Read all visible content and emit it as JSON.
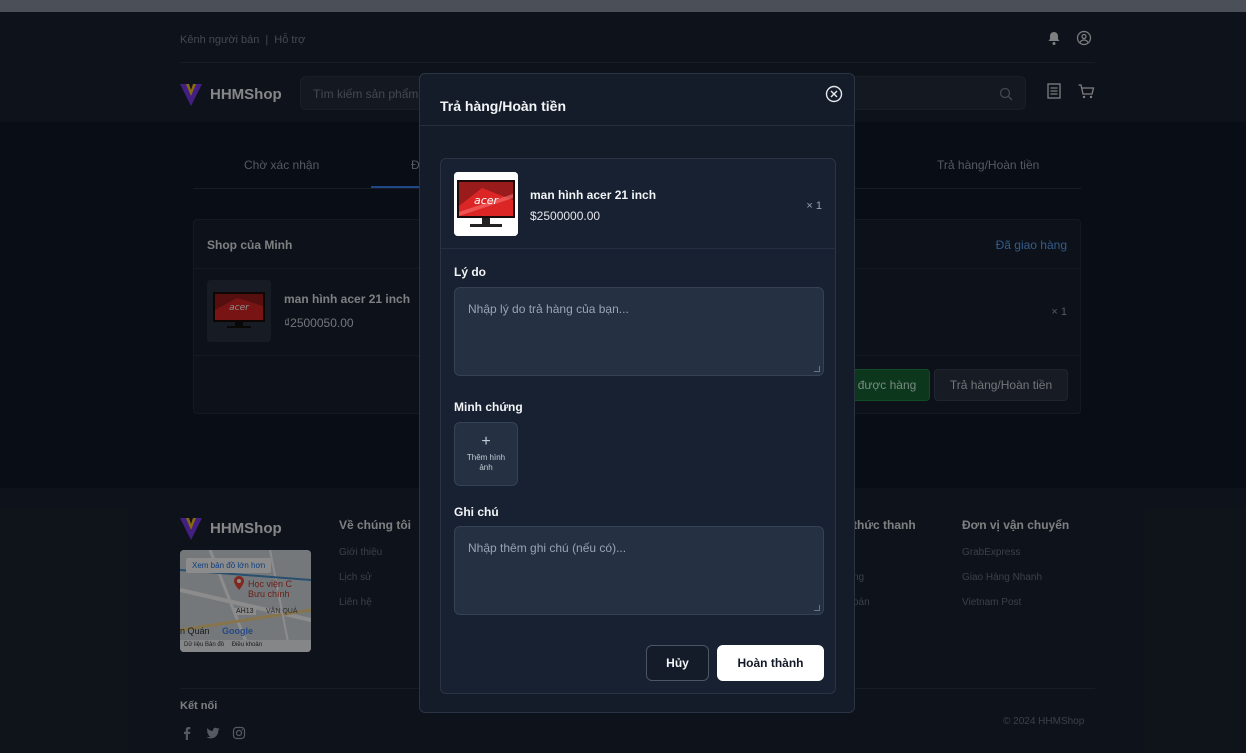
{
  "topbar": {
    "seller_channel": "Kênh người bán",
    "separator": "|",
    "support": "Hỗ trợ"
  },
  "header": {
    "brand": "HHMShop",
    "search_placeholder": "Tìm kiếm sản phẩm"
  },
  "tabs": [
    {
      "label": "Chờ xác nhận"
    },
    {
      "label": "Đ"
    },
    {
      "label": "Trả hàng/Hoàn tiền"
    }
  ],
  "order": {
    "shop_name": "Shop của Minh",
    "status": "Đã giao hàng",
    "product_name": "man hình acer 21 inch",
    "product_price": "₫2500050.00",
    "quantity": "× 1",
    "received_button": "được hàng",
    "return_button": "Trả hàng/Hoàn tiền"
  },
  "footer": {
    "brand": "HHMShop",
    "map": {
      "view_larger": "Xem bản đồ lớn hơn",
      "place_name": "Học viện C",
      "place_name2": "Bưu chính",
      "road": "AH13",
      "area": "VĂN QUÁ",
      "district": "n Quán",
      "google": "Google",
      "map_data": "Dữ liệu Bản đồ",
      "terms": "Điều khoản"
    },
    "about": {
      "heading": "Về chúng tôi",
      "links": [
        "Giới thiệu",
        "Lịch sử",
        "Liên hệ"
      ]
    },
    "payment": {
      "heading": "thức thanh",
      "links": [
        "ng",
        "oán"
      ]
    },
    "shipping": {
      "heading": "Đơn vị vận chuyển",
      "links": [
        "GrabExpress",
        "Giao Hàng Nhanh",
        "Vietnam Post"
      ]
    },
    "connect": "Kết nối",
    "copyright": "© 2024 HHMShop"
  },
  "modal": {
    "title": "Trả hàng/Hoàn tiền",
    "product_name": "man hình acer 21 inch",
    "product_price": "$2500000.00",
    "quantity": "× 1",
    "reason_label": "Lý do",
    "reason_placeholder": "Nhập lý do trả hàng của bạn...",
    "evidence_label": "Minh chứng",
    "add_image_plus": "+",
    "add_image_text": "Thêm hình ảnh",
    "note_label": "Ghi chú",
    "note_placeholder": "Nhập thêm ghi chú (nếu có)...",
    "cancel_button": "Hủy",
    "done_button": "Hoàn thành"
  },
  "colors": {
    "accent_blue": "#3b82f6",
    "success_green": "#166534",
    "background": "#111827"
  }
}
